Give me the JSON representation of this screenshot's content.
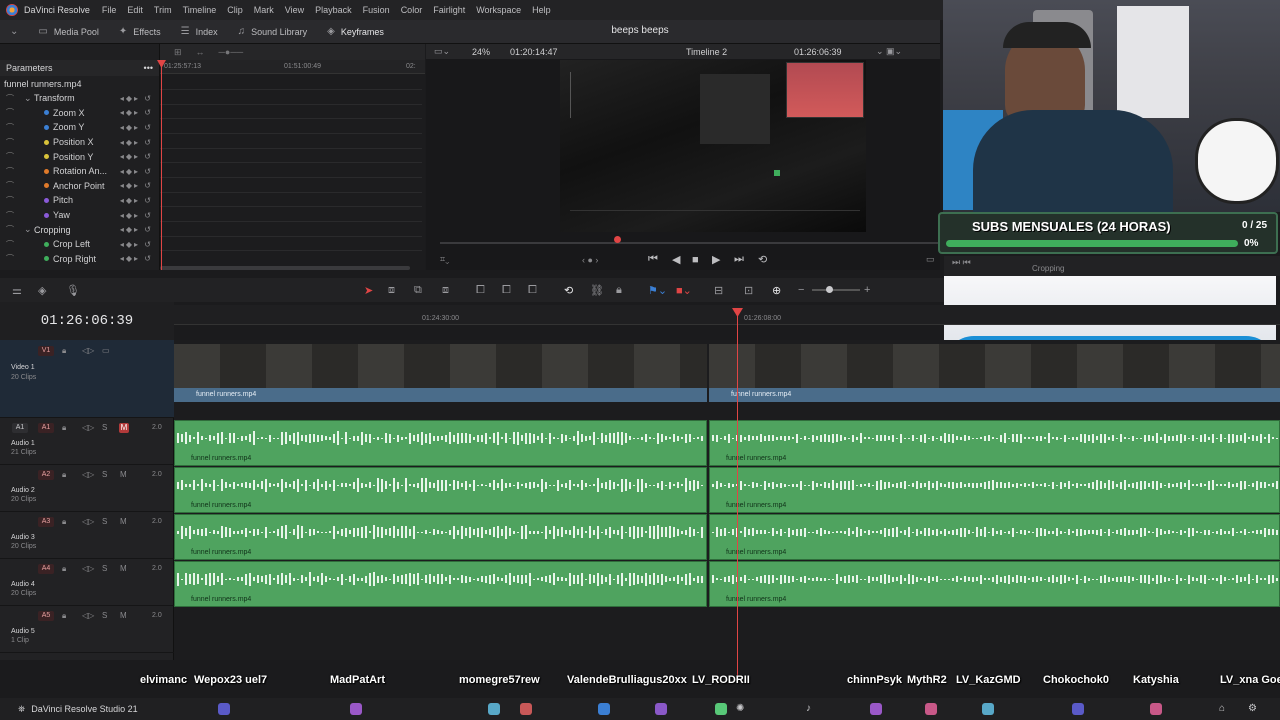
{
  "menubar": {
    "app_name": "DaVinci Resolve",
    "items": [
      "File",
      "Edit",
      "Trim",
      "Timeline",
      "Clip",
      "Mark",
      "View",
      "Playback",
      "Fusion",
      "Color",
      "Fairlight",
      "Workspace",
      "Help"
    ]
  },
  "toolbar": {
    "media_pool": "Media Pool",
    "effects": "Effects",
    "index": "Index",
    "sound_library": "Sound Library",
    "keyframes": "Keyframes"
  },
  "project_title": "beeps beeps",
  "inspector": {
    "header": "Parameters",
    "clip_name": "funnel runners.mp4",
    "params": [
      {
        "name": "Transform",
        "group": true,
        "color": ""
      },
      {
        "name": "Zoom X",
        "group": false,
        "color": "#3b7fd4"
      },
      {
        "name": "Zoom Y",
        "group": false,
        "color": "#3b7fd4"
      },
      {
        "name": "Position X",
        "group": false,
        "color": "#d8c23a"
      },
      {
        "name": "Position Y",
        "group": false,
        "color": "#d8c23a"
      },
      {
        "name": "Rotation An...",
        "group": false,
        "color": "#e07a2a"
      },
      {
        "name": "Anchor Point",
        "group": false,
        "color": "#e07a2a"
      },
      {
        "name": "Pitch",
        "group": false,
        "color": "#8a5ad8"
      },
      {
        "name": "Yaw",
        "group": false,
        "color": "#8a5ad8"
      },
      {
        "name": "Cropping",
        "group": true,
        "color": ""
      },
      {
        "name": "Crop Left",
        "group": false,
        "color": "#3fae5c"
      },
      {
        "name": "Crop Right",
        "group": false,
        "color": "#3fae5c"
      }
    ]
  },
  "keyframe_ruler": {
    "t1": "01:25:57:13",
    "t2": "01:51:00:49",
    "t3": "02:"
  },
  "viewer": {
    "zoom": "24%",
    "source_timecode": "01:20:14:47",
    "timeline_name": "Timeline 2",
    "record_timecode": "01:26:06:39"
  },
  "overlay": {
    "subs_title": "SUBS MENSUALES (24 HORAS)",
    "subs_count": "0 / 25",
    "subs_percent": "0%",
    "subs_progress": 0,
    "cropping_label": "Cropping"
  },
  "timeline": {
    "timecode": "01:26:06:39",
    "ruler": {
      "t1": "01:24:30:00",
      "t2": "01:26:08:00"
    },
    "tracks": [
      {
        "id": "V1",
        "name": "Video 1",
        "clips": "20 Clips",
        "vol": ""
      },
      {
        "id": "A1",
        "name": "Audio 1",
        "clips": "21 Clips",
        "vol": "2.0"
      },
      {
        "id": "A2",
        "name": "Audio 2",
        "clips": "20 Clips",
        "vol": "2.0"
      },
      {
        "id": "A3",
        "name": "Audio 3",
        "clips": "20 Clips",
        "vol": "2.0"
      },
      {
        "id": "A4",
        "name": "Audio 4",
        "clips": "20 Clips",
        "vol": "2.0"
      },
      {
        "id": "A5",
        "name": "Audio 5",
        "clips": "1 Clip",
        "vol": "2.0"
      }
    ],
    "clip_name": "funnel runners.mp4"
  },
  "chat": [
    "elvimanc",
    "Wepox23 uel7",
    "MadPatArt",
    "momegre57rew",
    "ValendeBrulliagus20xx",
    "LV_RODRII",
    "chinnPsyk",
    "MythR2",
    "LV_KazGMD",
    "Chokochok0",
    "Katyshia",
    "LV_xna Goe"
  ],
  "taskbar": {
    "label": "DaVinci Resolve Studio 21"
  }
}
